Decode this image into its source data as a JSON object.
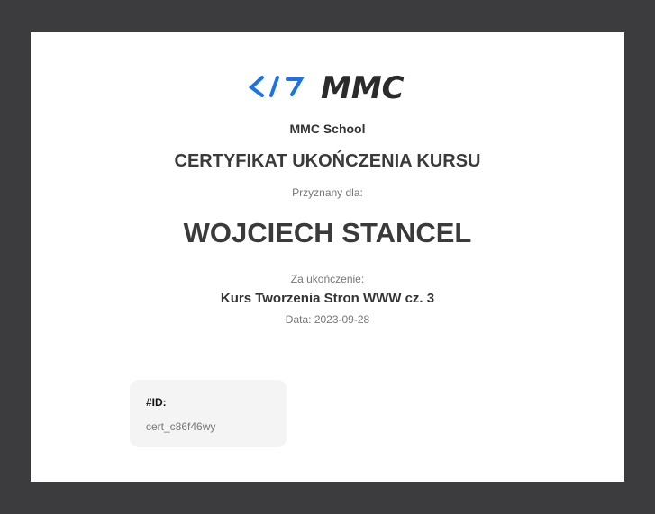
{
  "logo": {
    "code_mark": "</>",
    "brand": "MMC",
    "code_color": "#1a73e8",
    "brand_color": "#2b2b2b"
  },
  "school": "MMC School",
  "title": "CERTYFIKAT UKOŃCZENIA KURSU",
  "awarded_label": "Przyznany dla:",
  "recipient": "WOJCIECH STANCEL",
  "for_label": "Za ukończenie:",
  "course": "Kurs Tworzenia Stron WWW cz. 3",
  "date": "Data: 2023-09-28",
  "id": {
    "label": "#ID:",
    "value": "cert_c86f46wy"
  }
}
